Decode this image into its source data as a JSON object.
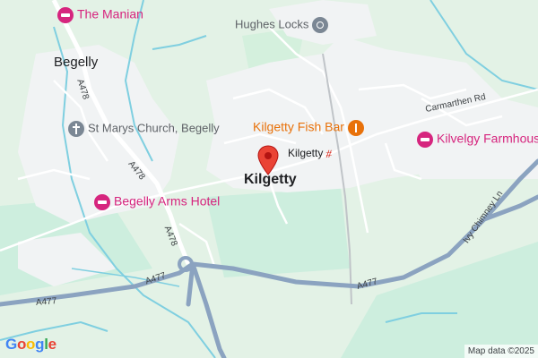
{
  "map": {
    "places": {
      "the_manian": "The Manian",
      "begelly": "Begelly",
      "hughes_locks": "Hughes Locks",
      "st_marys": "St Marys Church, Begelly",
      "fish_bar": "Kilgetty Fish Bar",
      "kilvelgy": "Kilvelgy Farmhouse",
      "kilgetty_station": "Kilgetty",
      "kilgetty_town": "Kilgetty",
      "begelly_arms": "Begelly Arms Hotel"
    },
    "roads": {
      "a478_north": "A478",
      "a478_mid": "A478",
      "a478_south": "A478",
      "a477_west": "A477",
      "a477_east": "A477",
      "a477_ne": "A477",
      "carmarthen_rd": "Carmarthen Rd",
      "ivy_chimney": "Ivy Chimney Ln"
    },
    "attribution": "Map data ©2025",
    "logo": "Google",
    "logo_colors": [
      "#4285F4",
      "#EA4335",
      "#FBBC05",
      "#4285F4",
      "#34A853",
      "#EA4335"
    ],
    "icons": {
      "hotel": "hotel-icon",
      "food": "restaurant-icon",
      "church": "church-icon",
      "lock": "landmark-icon",
      "pin": "location-pin-icon",
      "rail": "train-station-icon"
    },
    "colors": {
      "motorway": "#8ba3c0",
      "water": "#7fcfe0",
      "urban": "#f1f3f4",
      "green": "#cdeede",
      "pin": "#ea4335"
    }
  }
}
